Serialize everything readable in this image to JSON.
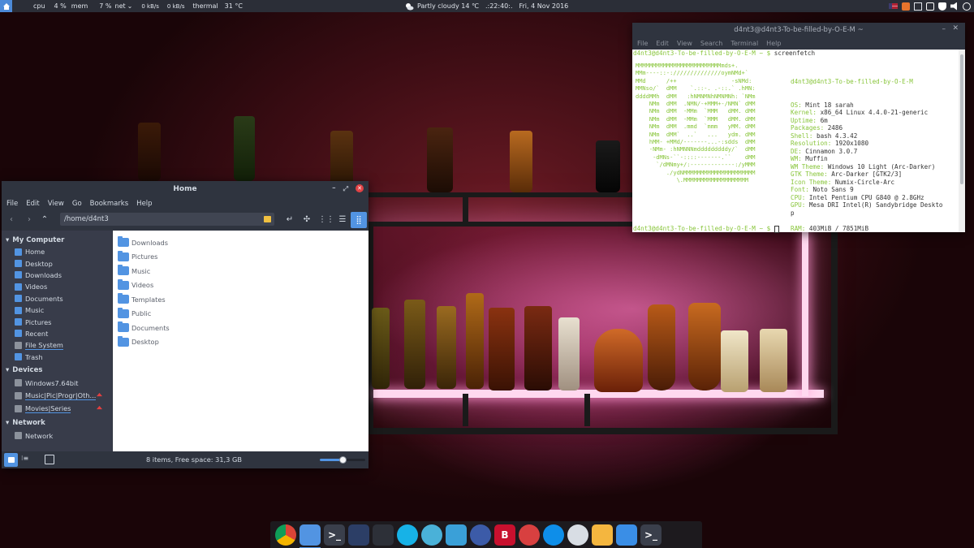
{
  "top_panel": {
    "cpu_label": "cpu",
    "cpu_value": "4 %",
    "mem_label": "mem",
    "mem_value": "7 %",
    "net_label": "net",
    "net_down": "0 kB/s",
    "net_up": "0 kB/s",
    "thermal_label": "thermal",
    "thermal_value": "31 °C",
    "weather": "Partly cloudy 14 ℃",
    "time": ".:22:40:.",
    "date": "Fri, 4 Nov 2016"
  },
  "file_manager": {
    "title": "Home",
    "menu": [
      "File",
      "Edit",
      "View",
      "Go",
      "Bookmarks",
      "Help"
    ],
    "path": "/home/d4nt3",
    "sidebar": {
      "computer_heading": "My Computer",
      "computer_items": [
        "Home",
        "Desktop",
        "Downloads",
        "Videos",
        "Documents",
        "Music",
        "Pictures",
        "Recent",
        "File System",
        "Trash"
      ],
      "devices_heading": "Devices",
      "device_items": [
        "Windows7.64bit",
        "Music|Pic|Progr|Oth...",
        "Movies|Series"
      ],
      "network_heading": "Network",
      "network_items": [
        "Network"
      ]
    },
    "files": [
      "Downloads",
      "Pictures",
      "Music",
      "Videos",
      "Templates",
      "Public",
      "Documents",
      "Desktop"
    ],
    "status": "8 items, Free space: 31,3 GB",
    "zoom_fraction": 0.5
  },
  "terminal": {
    "title": "d4nt3@d4nt3-To-be-filled-by-O-E-M ~",
    "menu": [
      "File",
      "Edit",
      "View",
      "Search",
      "Terminal",
      "Help"
    ],
    "prompt": "d4nt3@d4nt3-To-be-filled-by-O-E-M ~ $",
    "command": "screenfetch",
    "logo_lines": [
      "MMMMMMMMMMMMMMMMMMMMMMMMMmds+.",
      "MMm----::-://////////////oymNMd+`",
      "MMd      /++                -sNMd:",
      "MMNso/`  dMM    `.::-. .-::.` .hMN:",
      "ddddMMh  dMM   :hNMNMNhNMNMNh: `NMm",
      "    NMm  dMM  .NMN/-+MMM+-/NMN` dMM",
      "    NMm  dMM  -MMm  `MMM   dMM. dMM",
      "    NMm  dMM  -MMm  `MMM   dMM. dMM",
      "    NMm  dMM  .mmd  `mmm   yMM. dMM",
      "    NMm  dMM`  ..`   ...   ydm. dMM",
      "    hMM- +MMd/-------...-:sdds  dMM",
      "    -NMm- :hNMNNNmdddddddddy/`  dMM",
      "     -dMNs-``-::::-------.``    dMM",
      "      `/dMNmy+/:-------------:/yMMM",
      "         ./ydNMMMMMMMMMMMMMMMMMMMMM",
      "            \\.MMMMMMMMMMMMMMMMMMM"
    ],
    "user_host": "d4nt3@d4nt3-To-be-filled-by-O-E-M",
    "info": [
      {
        "key": "OS:",
        "value": "Mint 18 sarah"
      },
      {
        "key": "Kernel:",
        "value": "x86_64 Linux 4.4.0-21-generic"
      },
      {
        "key": "Uptime:",
        "value": "6m"
      },
      {
        "key": "Packages:",
        "value": "2486"
      },
      {
        "key": "Shell:",
        "value": "bash 4.3.42"
      },
      {
        "key": "Resolution:",
        "value": "1920x1080"
      },
      {
        "key": "DE:",
        "value": "Cinnamon 3.0.7"
      },
      {
        "key": "WM:",
        "value": "Muffin"
      },
      {
        "key": "WM Theme:",
        "value": "Windows 10 Light (Arc-Darker)"
      },
      {
        "key": "GTK Theme:",
        "value": "Arc-Darker [GTK2/3]"
      },
      {
        "key": "Icon Theme:",
        "value": "Numix-Circle-Arc"
      },
      {
        "key": "Font:",
        "value": "Noto Sans 9"
      },
      {
        "key": "CPU:",
        "value": "Intel Pentium CPU G840 @ 2.8GHz"
      },
      {
        "key": "GPU:",
        "value": "Mesa DRI Intel(R) Sandybridge Deskto"
      },
      {
        "key": "",
        "value": "p"
      },
      {
        "key": "",
        "value": ""
      },
      {
        "key": "RAM:",
        "value": "403MiB / 7851MiB"
      }
    ]
  },
  "dock": {
    "apps": [
      {
        "name": "chrome-icon",
        "glyph": ""
      },
      {
        "name": "files-icon",
        "glyph": ""
      },
      {
        "name": "terminal-icon",
        "glyph": ">_"
      },
      {
        "name": "app-grid-icon",
        "glyph": ""
      },
      {
        "name": "dashboard-icon",
        "glyph": ""
      },
      {
        "name": "kodi-icon",
        "glyph": ""
      },
      {
        "name": "calculator-icon",
        "glyph": ""
      },
      {
        "name": "system-monitor-icon",
        "glyph": ""
      },
      {
        "name": "disk-usage-icon",
        "glyph": ""
      },
      {
        "name": "bitdefender-icon",
        "glyph": "B"
      },
      {
        "name": "flask-icon",
        "glyph": ""
      },
      {
        "name": "teamviewer-icon",
        "glyph": ""
      },
      {
        "name": "toggle-icon",
        "glyph": ""
      },
      {
        "name": "notes-icon",
        "glyph": ""
      },
      {
        "name": "trash-icon",
        "glyph": ""
      },
      {
        "name": "terminal-2-icon",
        "glyph": ">_"
      }
    ]
  },
  "colors": {
    "accent": "#5294e2",
    "panel": "#2b2e37",
    "window": "#2f343f",
    "terminal_green": "#88c53a"
  }
}
